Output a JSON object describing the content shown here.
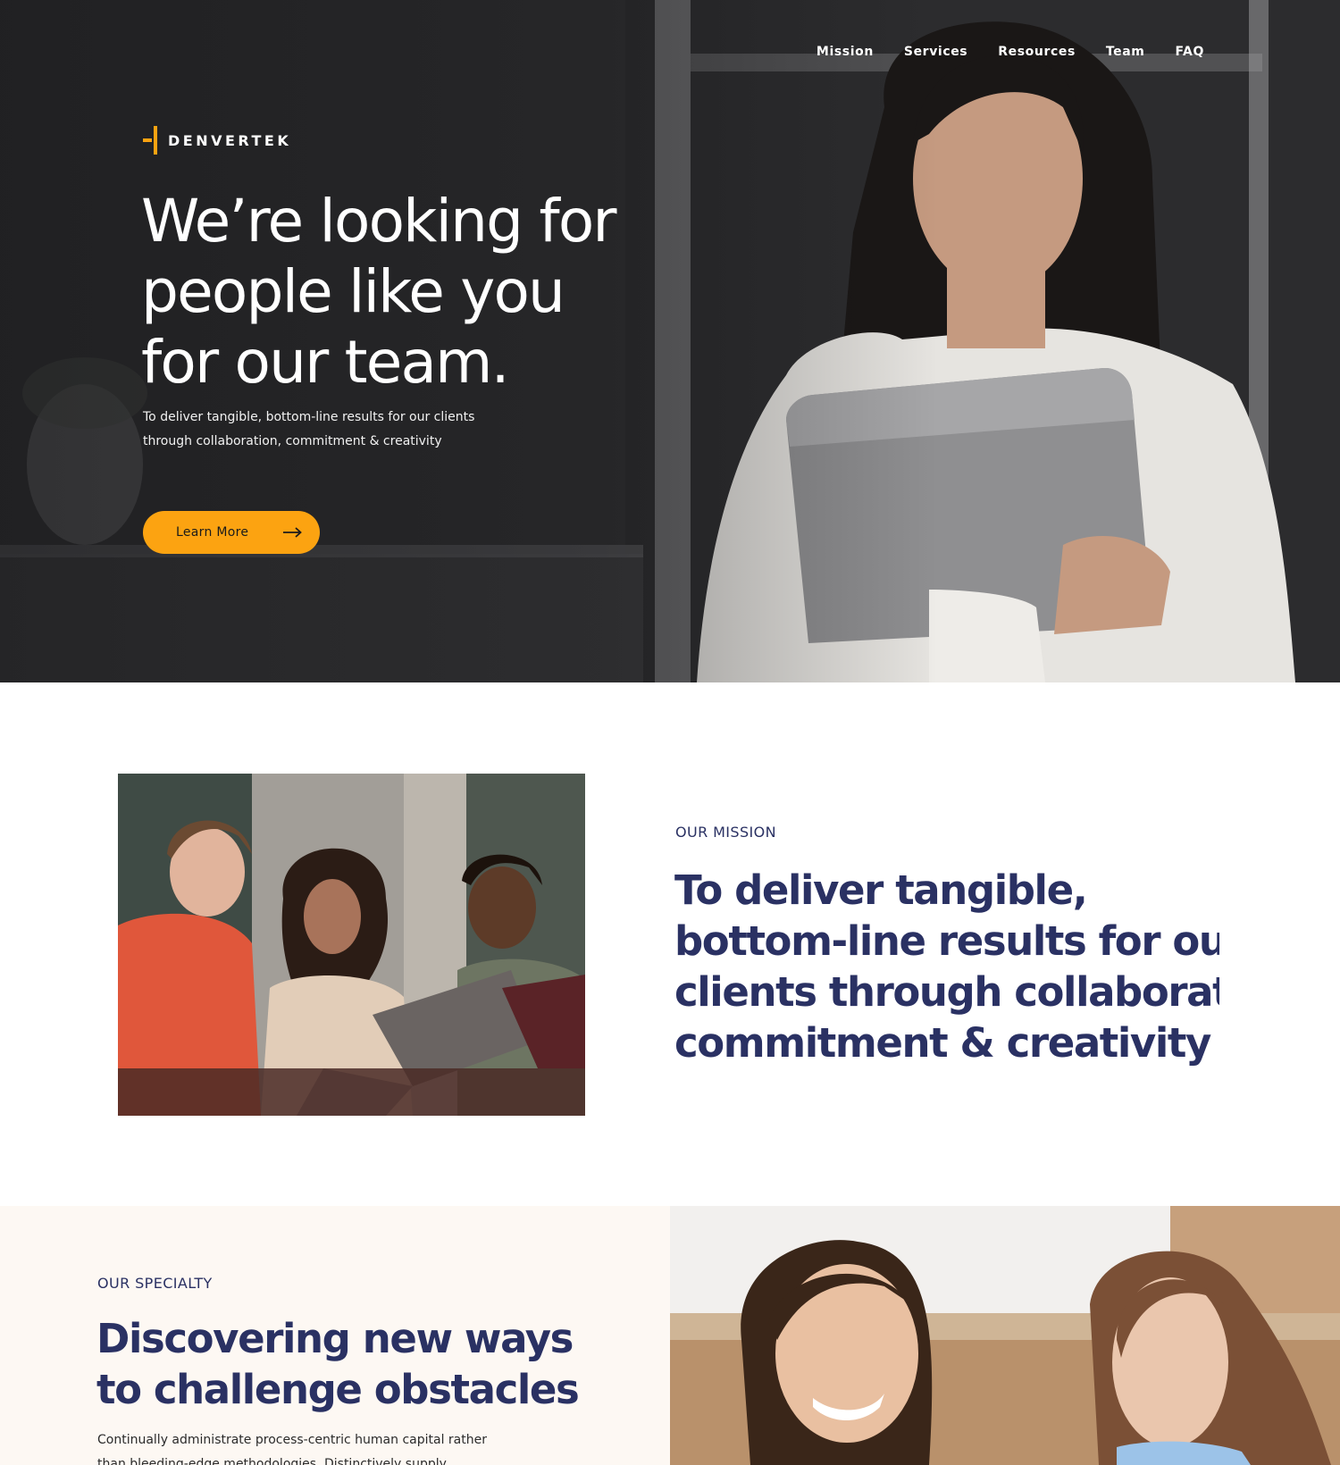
{
  "brand": {
    "name": "DENVERTEK",
    "accent": "#fca311",
    "navy": "#2a3163"
  },
  "nav": {
    "items": [
      "Mission",
      "Services",
      "Resources",
      "Team",
      "FAQ"
    ]
  },
  "hero": {
    "title_lines": [
      "We’re looking for",
      "people like you",
      "for our team."
    ],
    "subtitle_lines": [
      "To deliver tangible, bottom-line results for our clients",
      "through collaboration, commitment & creativity"
    ],
    "button_label": "Learn More",
    "button_icon": "arrow-right-icon",
    "image": "woman-holding-laptop-photo"
  },
  "mission": {
    "eyebrow": "OUR MISSION",
    "statement_lines": [
      "To deliver tangible,",
      "bottom-line results for our",
      "clients through collaboration,",
      "commitment & creativity"
    ],
    "image": "team-around-laptop-photo"
  },
  "specialty": {
    "eyebrow": "OUR SPECIALTY",
    "title_lines": [
      "Discovering new ways",
      "to challenge obstacles"
    ],
    "body_lines": [
      "Continually administrate process-centric human capital rather",
      "than bleeding-edge methodologies. Distinctively supply"
    ],
    "image": "two-women-talking-photo"
  }
}
